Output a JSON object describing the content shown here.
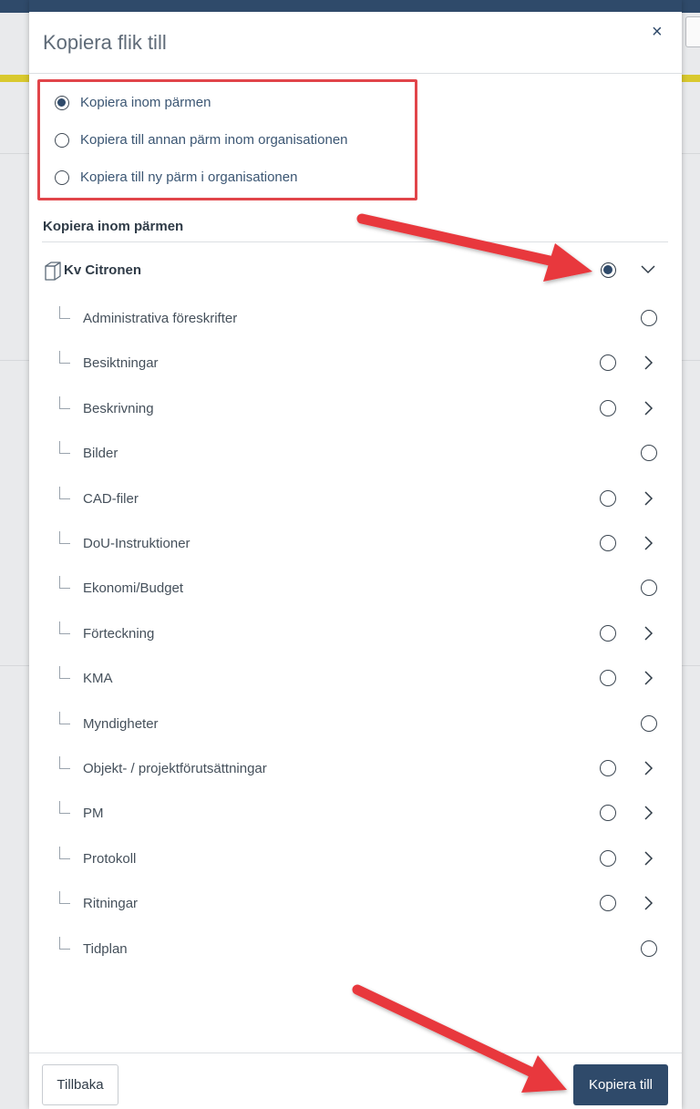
{
  "modal": {
    "title": "Kopiera flik till",
    "close_icon": "×"
  },
  "copy_options": [
    {
      "label": "Kopiera inom pärmen",
      "selected": true
    },
    {
      "label": "Kopiera till annan pärm inom organisationen",
      "selected": false
    },
    {
      "label": "Kopiera till ny pärm i organisationen",
      "selected": false
    }
  ],
  "section": {
    "title": "Kopiera inom pärmen"
  },
  "tree": {
    "root": {
      "label": "Kv Citronen",
      "icon": "binder-icon",
      "selected": true,
      "expanded": true
    },
    "items": [
      {
        "label": "Administrativa föreskrifter",
        "has_children": false
      },
      {
        "label": "Besiktningar",
        "has_children": true
      },
      {
        "label": "Beskrivning",
        "has_children": true
      },
      {
        "label": "Bilder",
        "has_children": false
      },
      {
        "label": "CAD-filer",
        "has_children": true
      },
      {
        "label": "DoU-Instruktioner",
        "has_children": true
      },
      {
        "label": "Ekonomi/Budget",
        "has_children": false
      },
      {
        "label": "Förteckning",
        "has_children": true
      },
      {
        "label": "KMA",
        "has_children": true
      },
      {
        "label": "Myndigheter",
        "has_children": false
      },
      {
        "label": "Objekt- / projektförutsättningar",
        "has_children": true
      },
      {
        "label": "PM",
        "has_children": true
      },
      {
        "label": "Protokoll",
        "has_children": true
      },
      {
        "label": "Ritningar",
        "has_children": true
      },
      {
        "label": "Tidplan",
        "has_children": false
      }
    ]
  },
  "footer": {
    "back_label": "Tillbaka",
    "copy_label": "Kopiera till"
  },
  "colors": {
    "primary": "#2f4a6a",
    "highlight": "#e1454a",
    "accent_yellow": "#d9c92e"
  }
}
